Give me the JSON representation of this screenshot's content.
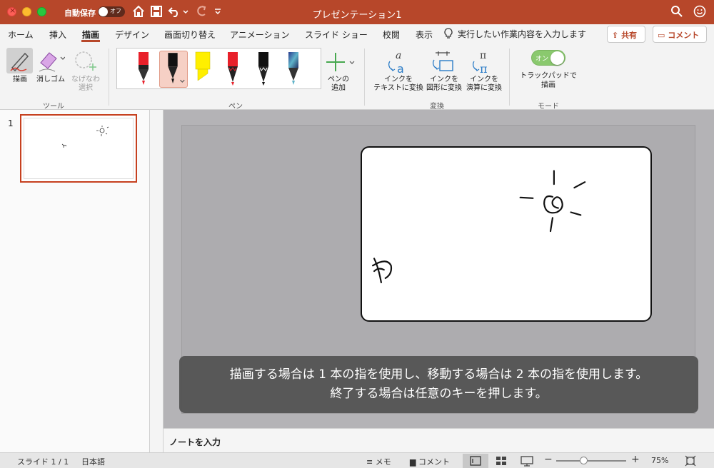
{
  "titlebar": {
    "autosave_label": "自動保存",
    "autosave_state": "オフ",
    "title": "プレゼンテーション1"
  },
  "tabs": [
    "ホーム",
    "挿入",
    "描画",
    "デザイン",
    "画面切り替え",
    "アニメーション",
    "スライド ショー",
    "校閲",
    "表示"
  ],
  "active_tab": "描画",
  "tell_me": "実行したい作業内容を入力します",
  "share": "共有",
  "comment": "コメント",
  "ribbon": {
    "tools": {
      "draw": "描画",
      "eraser": "消しゴム",
      "lasso_line1": "なげなわ",
      "lasso_line2": "選択",
      "group": "ツール"
    },
    "pens": {
      "add_line1": "ペンの",
      "add_line2": "追加",
      "group": "ペン"
    },
    "convert": {
      "ink_text_1": "インクを",
      "ink_text_2": "テキストに変換",
      "ink_shape_1": "インクを",
      "ink_shape_2": "図形に変換",
      "ink_math_1": "インクを",
      "ink_math_2": "演算に変換",
      "group": "変換"
    },
    "mode": {
      "toggle_state": "オン",
      "trackpad_line1": "トラックパッドで",
      "trackpad_line2": "描画",
      "group": "モード"
    }
  },
  "thumbnail": {
    "number": "1"
  },
  "overlay": {
    "line1": "描画する場合は 1 本の指を使用し、移動する場合は 2 本の指を使用します。",
    "line2": "終了する場合は任意のキーを押します。"
  },
  "notes_placeholder": "ノートを入力",
  "status": {
    "slide": "スライド 1 / 1",
    "language": "日本語",
    "notes": "メモ",
    "comments": "コメント",
    "zoom": "75%"
  },
  "colors": {
    "accent": "#b7472a",
    "pen_red": "#e8202a",
    "pen_yellow": "#ffef00"
  }
}
